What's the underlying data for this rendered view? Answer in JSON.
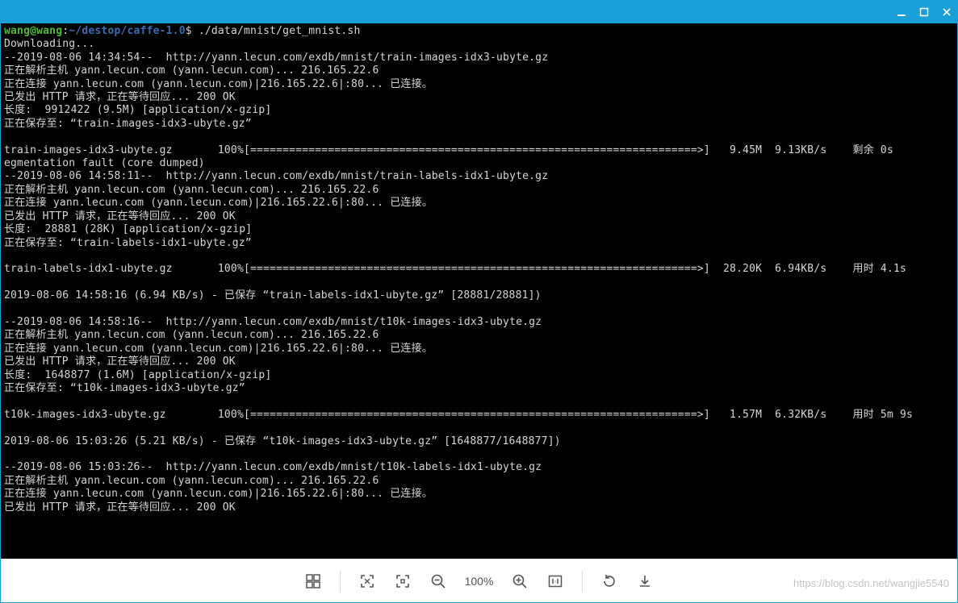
{
  "prompt": {
    "user_host": "wang@wang",
    "colon": ":",
    "path": "~/destop/caffe-1.0",
    "dollar": "$",
    "command": " ./data/mnist/get_mnist.sh"
  },
  "lines": [
    "Downloading...",
    "--2019-08-06 14:34:54--  http://yann.lecun.com/exdb/mnist/train-images-idx3-ubyte.gz",
    "正在解析主机 yann.lecun.com (yann.lecun.com)... 216.165.22.6",
    "正在连接 yann.lecun.com (yann.lecun.com)|216.165.22.6|:80... 已连接。",
    "已发出 HTTP 请求，正在等待回应... 200 OK",
    "长度:  9912422 (9.5M) [application/x-gzip]",
    "正在保存至: “train-images-idx3-ubyte.gz”",
    "",
    "train-images-idx3-ubyte.gz       100%[=====================================================================>]   9.45M  9.13KB/s    剩余 0s",
    "egmentation fault (core dumped)",
    "--2019-08-06 14:58:11--  http://yann.lecun.com/exdb/mnist/train-labels-idx1-ubyte.gz",
    "正在解析主机 yann.lecun.com (yann.lecun.com)... 216.165.22.6",
    "正在连接 yann.lecun.com (yann.lecun.com)|216.165.22.6|:80... 已连接。",
    "已发出 HTTP 请求，正在等待回应... 200 OK",
    "长度:  28881 (28K) [application/x-gzip]",
    "正在保存至: “train-labels-idx1-ubyte.gz”",
    "",
    "train-labels-idx1-ubyte.gz       100%[=====================================================================>]  28.20K  6.94KB/s    用时 4.1s",
    "",
    "2019-08-06 14:58:16 (6.94 KB/s) - 已保存 “train-labels-idx1-ubyte.gz” [28881/28881])",
    "",
    "--2019-08-06 14:58:16--  http://yann.lecun.com/exdb/mnist/t10k-images-idx3-ubyte.gz",
    "正在解析主机 yann.lecun.com (yann.lecun.com)... 216.165.22.6",
    "正在连接 yann.lecun.com (yann.lecun.com)|216.165.22.6|:80... 已连接。",
    "已发出 HTTP 请求，正在等待回应... 200 OK",
    "长度:  1648877 (1.6M) [application/x-gzip]",
    "正在保存至: “t10k-images-idx3-ubyte.gz”",
    "",
    "t10k-images-idx3-ubyte.gz        100%[=====================================================================>]   1.57M  6.32KB/s    用时 5m 9s",
    "",
    "2019-08-06 15:03:26 (5.21 KB/s) - 已保存 “t10k-images-idx3-ubyte.gz” [1648877/1648877])",
    "",
    "--2019-08-06 15:03:26--  http://yann.lecun.com/exdb/mnist/t10k-labels-idx1-ubyte.gz",
    "正在解析主机 yann.lecun.com (yann.lecun.com)... 216.165.22.6",
    "正在连接 yann.lecun.com (yann.lecun.com)|216.165.22.6|:80... 已连接。",
    "已发出 HTTP 请求，正在等待回应... 200 OK"
  ],
  "toolbar": {
    "zoom_label": "100%"
  },
  "watermark": "https://blog.csdn.net/wangjie5540"
}
